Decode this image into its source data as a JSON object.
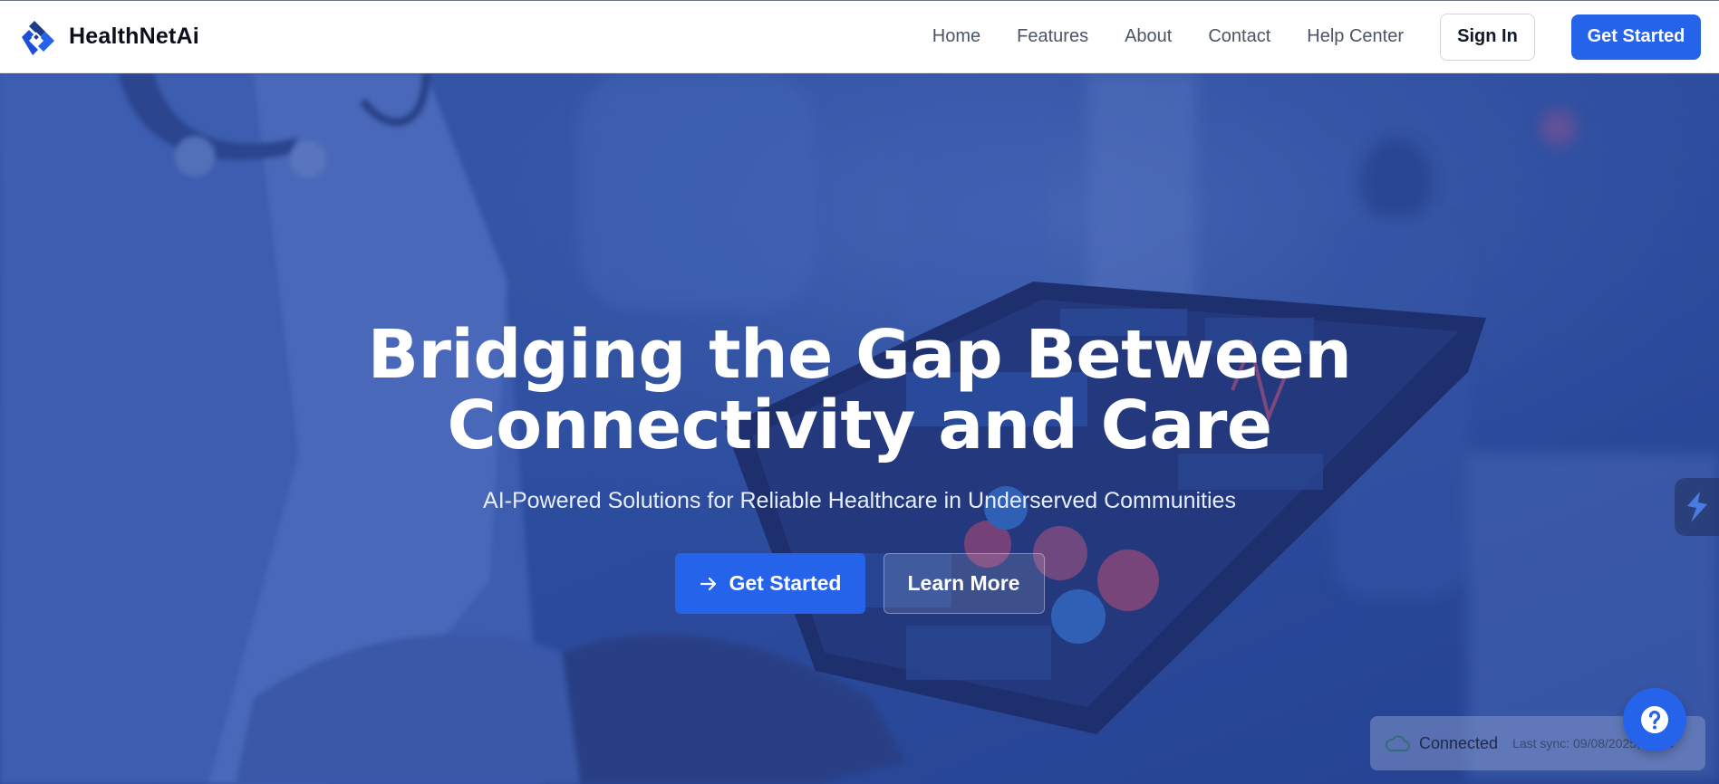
{
  "brand": {
    "name": "HealthNetAi"
  },
  "nav": {
    "links": [
      "Home",
      "Features",
      "About",
      "Contact",
      "Help Center"
    ],
    "sign_in": "Sign In",
    "get_started": "Get Started"
  },
  "hero": {
    "title_line1": "Bridging the Gap Between",
    "title_line2": "Connectivity and Care",
    "subtitle": "AI-Powered Solutions for Reliable Healthcare in Underserved Communities",
    "primary_cta": "Get Started",
    "secondary_cta": "Learn More"
  },
  "status": {
    "label": "Connected",
    "last_sync": "Last sync: 09/08/2025, …:16"
  },
  "icons": {
    "logo": "healthnetai-logo-icon",
    "arrow": "arrow-right-icon",
    "cloud": "cloud-icon",
    "help": "question-mark-icon",
    "side": "lightning-icon"
  },
  "colors": {
    "primary": "#2563eb",
    "hero_overlay": "#2c4891",
    "text_dark": "#0b0f19"
  }
}
